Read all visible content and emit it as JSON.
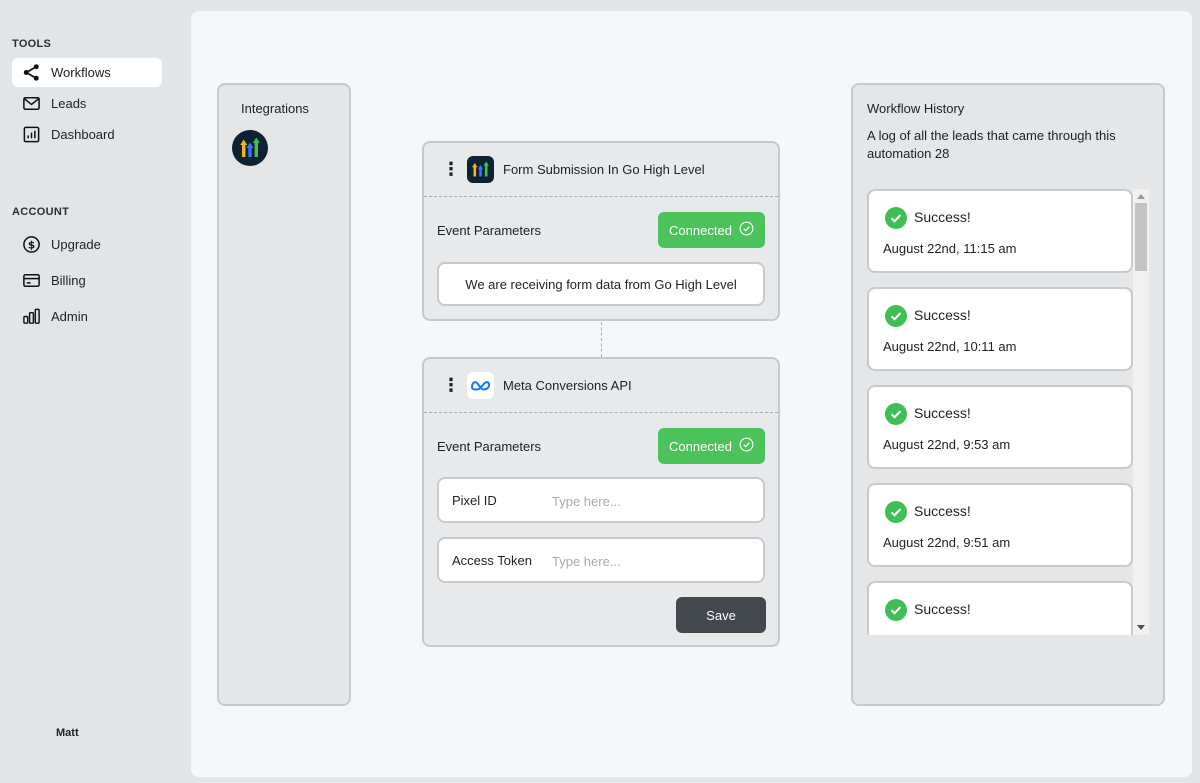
{
  "sidebar": {
    "tools_title": "TOOLS",
    "tools": [
      {
        "label": "Workflows",
        "icon": "workflow-icon",
        "active": true
      },
      {
        "label": "Leads",
        "icon": "mail-icon",
        "active": false
      },
      {
        "label": "Dashboard",
        "icon": "bar-chart-icon",
        "active": false
      }
    ],
    "account_title": "ACCOUNT",
    "account": [
      {
        "label": "Upgrade",
        "icon": "dollar-circle-icon"
      },
      {
        "label": "Billing",
        "icon": "credit-card-icon"
      },
      {
        "label": "Admin",
        "icon": "bars-icon"
      }
    ],
    "user_name": "Matt"
  },
  "integrations": {
    "title": "Integrations",
    "items": [
      {
        "icon": "go-high-level-logo"
      }
    ]
  },
  "workflow": {
    "trigger": {
      "name": "Form Submission In Go High Level",
      "params_label": "Event Parameters",
      "status": "Connected",
      "message": "We are receiving form data from Go High Level"
    },
    "action": {
      "name": "Meta Conversions API",
      "params_label": "Event Parameters",
      "status": "Connected",
      "fields": [
        {
          "label": "Pixel ID",
          "value": "",
          "placeholder": "Type here..."
        },
        {
          "label": "Access Token",
          "value": "",
          "placeholder": "Type here..."
        }
      ],
      "save_label": "Save"
    }
  },
  "history": {
    "title": "Workflow History",
    "description": "A log of all the leads that came through this automation 28",
    "entries": [
      {
        "status": "Success!",
        "time": "August 22nd, 11:15 am"
      },
      {
        "status": "Success!",
        "time": "August 22nd, 10:11 am"
      },
      {
        "status": "Success!",
        "time": "August 22nd, 9:53 am"
      },
      {
        "status": "Success!",
        "time": "August 22nd, 9:51 am"
      },
      {
        "status": "Success!",
        "time": ""
      }
    ]
  },
  "colors": {
    "connected": "#4cc35a",
    "success_check": "#3fbf55",
    "save_button": "#42484d",
    "page_bg": "#e2e5e8"
  }
}
